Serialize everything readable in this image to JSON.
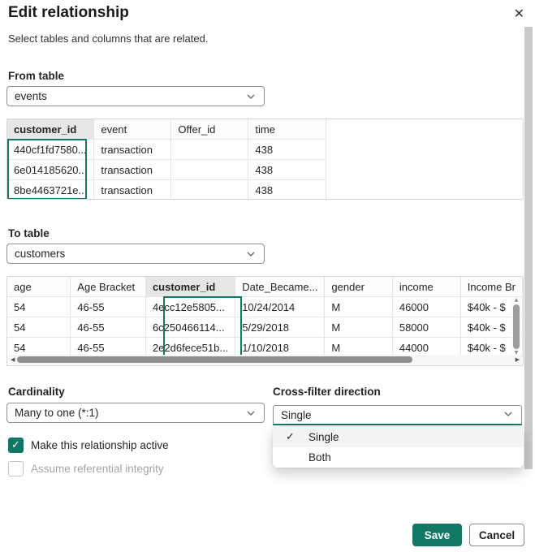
{
  "dialog": {
    "title": "Edit relationship",
    "subtitle": "Select tables and columns that are related."
  },
  "icons": {
    "close": "✕",
    "check": "✓",
    "arrow_left": "◀",
    "arrow_right": "▶",
    "arrow_up": "▲",
    "arrow_down": "▼"
  },
  "from_table": {
    "label": "From table",
    "selected": "events",
    "selected_column": "customer_id",
    "headers": [
      "customer_id",
      "event",
      "Offer_id",
      "time"
    ],
    "rows": [
      [
        "440cf1fd7580...",
        "transaction",
        "",
        "438"
      ],
      [
        "6e014185620...",
        "transaction",
        "",
        "438"
      ],
      [
        "8be4463721e...",
        "transaction",
        "",
        "438"
      ]
    ]
  },
  "to_table": {
    "label": "To table",
    "selected": "customers",
    "selected_column": "customer_id",
    "headers": [
      "age",
      "Age Bracket",
      "customer_id",
      "Date_Became...",
      "gender",
      "income",
      "Income Br"
    ],
    "rows": [
      [
        "54",
        "46-55",
        "4ecc12e5805...",
        "10/24/2014",
        "M",
        "46000",
        "$40k - $"
      ],
      [
        "54",
        "46-55",
        "6c250466114...",
        "5/29/2018",
        "M",
        "58000",
        "$40k - $"
      ],
      [
        "54",
        "46-55",
        "2e2d6fece51b...",
        "1/10/2018",
        "M",
        "44000",
        "$40k - $"
      ]
    ]
  },
  "cardinality": {
    "label": "Cardinality",
    "selected": "Many to one (*:1)"
  },
  "cross_filter": {
    "label": "Cross-filter direction",
    "selected": "Single",
    "options": [
      "Single",
      "Both"
    ],
    "checked_option": "Single"
  },
  "checkboxes": {
    "active_label": "Make this relationship active",
    "active_checked": true,
    "integrity_label": "Assume referential integrity",
    "integrity_checked": false,
    "integrity_disabled": true
  },
  "footer": {
    "save": "Save",
    "cancel": "Cancel"
  },
  "colors": {
    "accent": "#117865",
    "selected_header_bg": "#e6e6e6"
  }
}
